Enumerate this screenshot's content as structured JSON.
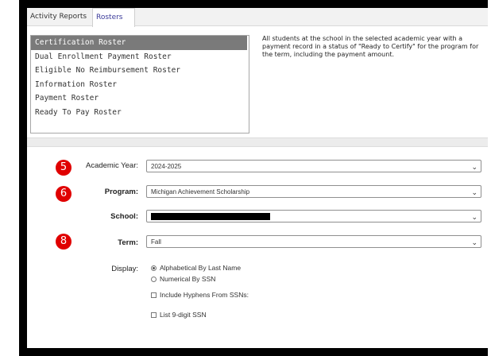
{
  "tabs": [
    {
      "label": "Activity Reports",
      "active": false
    },
    {
      "label": "Rosters",
      "active": true
    }
  ],
  "roster_list": {
    "selected": "Certification Roster",
    "items": [
      "Certification Roster",
      "Dual Enrollment Payment Roster",
      "Eligible No Reimbursement Roster",
      "Information Roster",
      "Payment Roster",
      "Ready To Pay Roster"
    ]
  },
  "description": "All students at the school in the selected academic year with a payment record in a status of \"Ready to Certify\" for the program for the term, including the payment amount.",
  "form": {
    "academic_year": {
      "label": "Academic Year:",
      "value": "2024-2025",
      "badge": "5"
    },
    "program": {
      "label": "Program:",
      "value": "Michigan Achievement Scholarship",
      "badge": "6"
    },
    "school": {
      "label": "School:",
      "value": ""
    },
    "term": {
      "label": "Term:",
      "value": "Fall",
      "badge": "8"
    },
    "display": {
      "label": "Display:",
      "options": [
        "Alphabetical By Last Name",
        "Numerical By SSN"
      ],
      "selected": "Alphabetical By Last Name"
    },
    "include_hyphens": {
      "label": "Include Hyphens From SSNs:",
      "checked": false
    },
    "list_9_digit": {
      "label": "List 9-digit SSN",
      "checked": false
    }
  },
  "colors": {
    "badge": "#e00000",
    "selected_item": "#7a7a7a",
    "active_tab_text": "#3b3b9a"
  },
  "icons": {
    "dropdown": "chevron-down-icon"
  }
}
